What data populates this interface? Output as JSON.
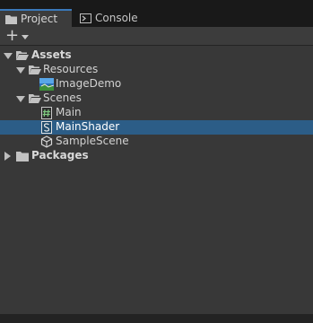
{
  "tabs": [
    {
      "label": "Project",
      "icon": "folder-icon",
      "active": true
    },
    {
      "label": "Console",
      "icon": "console-icon",
      "active": false
    }
  ],
  "toolbar": {
    "create_icon": "plus-icon",
    "dropdown_icon": "caret-down-icon"
  },
  "tree": [
    {
      "label": "Assets",
      "bold": true,
      "depth": 0,
      "expanded": true,
      "icon": "folder-open-icon"
    },
    {
      "label": "Resources",
      "bold": false,
      "depth": 1,
      "expanded": true,
      "icon": "folder-open-icon"
    },
    {
      "label": "ImageDemo",
      "bold": false,
      "depth": 2,
      "icon": "image-asset-icon"
    },
    {
      "label": "Scenes",
      "bold": false,
      "depth": 1,
      "expanded": true,
      "icon": "folder-open-icon"
    },
    {
      "label": "Main",
      "bold": false,
      "depth": 2,
      "icon": "csharp-script-icon"
    },
    {
      "label": "MainShader",
      "bold": false,
      "depth": 2,
      "icon": "shader-icon",
      "selected": true
    },
    {
      "label": "SampleScene",
      "bold": false,
      "depth": 2,
      "icon": "unity-scene-icon"
    },
    {
      "label": "Packages",
      "bold": true,
      "depth": 0,
      "expanded": false,
      "icon": "folder-icon"
    }
  ],
  "colors": {
    "selection": "#2c5d87",
    "tab_accent": "#3a79bb",
    "panel": "#383838"
  }
}
